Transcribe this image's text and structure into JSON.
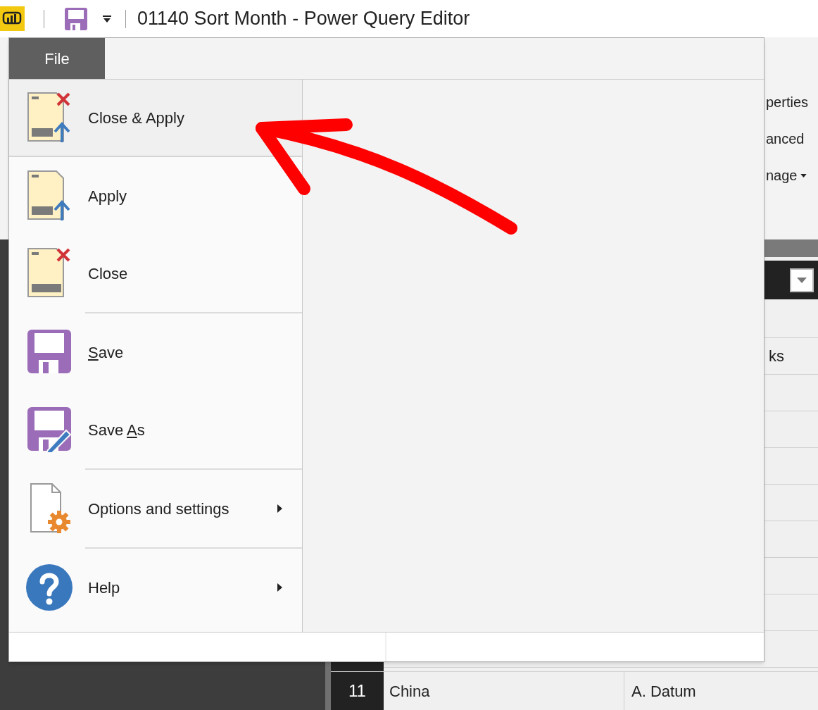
{
  "window": {
    "title": "01140 Sort Month - Power Query Editor"
  },
  "file_tab": {
    "label": "File",
    "selected": true
  },
  "file_menu": {
    "items": [
      {
        "label": {
          "before": "Close & Apply"
        },
        "selected": true,
        "submenu": false,
        "separator_before": false
      },
      {
        "label": {
          "before": "Apply"
        },
        "selected": false,
        "submenu": false,
        "separator_before": false
      },
      {
        "label": {
          "before": "Close"
        },
        "selected": false,
        "submenu": false,
        "separator_before": false
      },
      {
        "label": {
          "key": "S",
          "after": "ave"
        },
        "selected": false,
        "submenu": false,
        "separator_before": true
      },
      {
        "label": {
          "before": "Save ",
          "key": "A",
          "after": "s"
        },
        "selected": false,
        "submenu": false,
        "separator_before": false
      },
      {
        "label": {
          "before": "Options and settings"
        },
        "selected": false,
        "submenu": true,
        "separator_before": true
      },
      {
        "label": {
          "before": "Help"
        },
        "selected": false,
        "submenu": true,
        "separator_before": true
      }
    ]
  },
  "ribbon_fragments": [
    {
      "text": "perties",
      "dropdown": false
    },
    {
      "text": "anced",
      "dropdown": false
    },
    {
      "text": "nage",
      "dropdown": true
    }
  ],
  "table": {
    "rows": [
      {
        "column_2": "ks"
      },
      {
        "row_number": "11",
        "column_1": "China",
        "column_2": "A. Datum"
      }
    ]
  }
}
